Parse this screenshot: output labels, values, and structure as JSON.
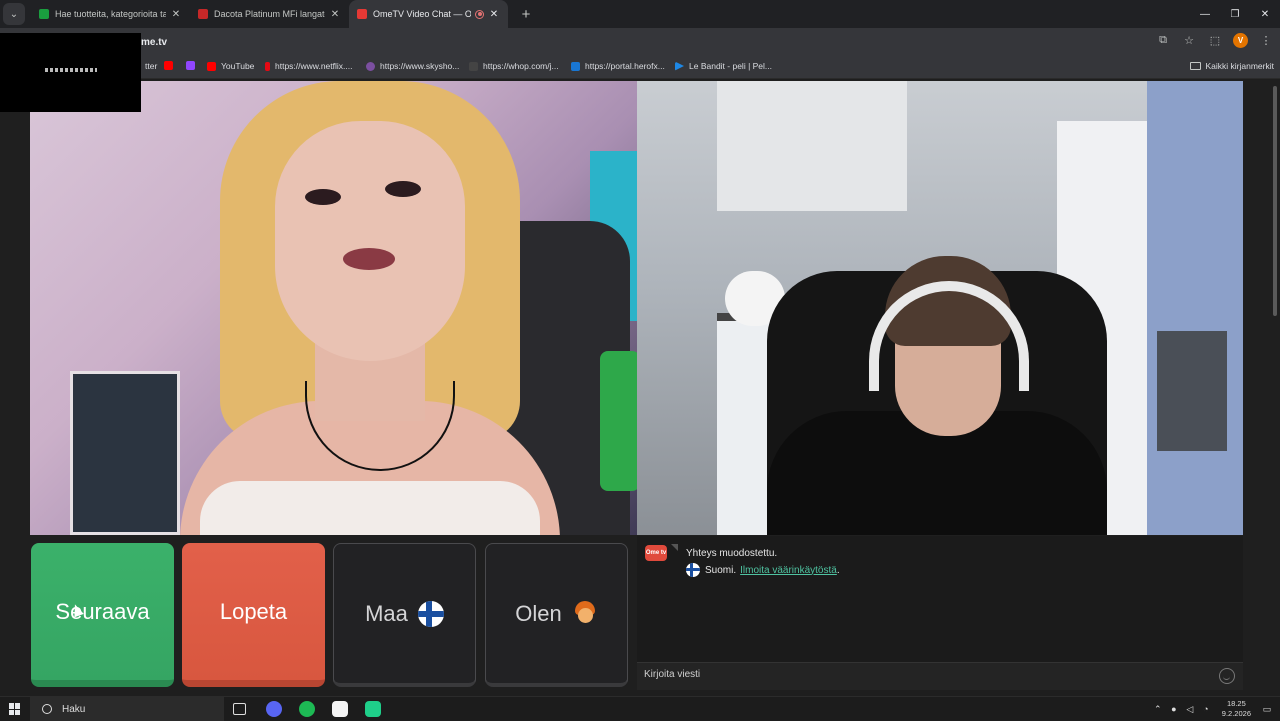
{
  "browser": {
    "tabs": [
      {
        "title": "Hae tuotteita, kategorioita tai a...",
        "favicon_color": "#1a9e3f",
        "active": false
      },
      {
        "title": "Dacota Platinum MFi langaton ...",
        "favicon_color": "#c62828",
        "active": false
      },
      {
        "title": "OmeTV Video Chat — Om...",
        "favicon_color": "#e53935",
        "active": true
      }
    ],
    "new_tab_label": "+",
    "url": "me.tv",
    "profile_initial": "V",
    "bookmarks": [
      {
        "label": "tter",
        "color": "#000000"
      },
      {
        "label": "",
        "color": "#ff0000"
      },
      {
        "label": "",
        "color": "#9146ff"
      },
      {
        "label": "YouTube",
        "color": "#ff0000"
      },
      {
        "label": "https://www.netflix....",
        "color": "#e50914"
      },
      {
        "label": "https://www.skysho...",
        "color": "#7b4fa0"
      },
      {
        "label": "https://whop.com/j...",
        "color": "#444444"
      },
      {
        "label": "https://portal.herofx...",
        "color": "#1976d2"
      },
      {
        "label": "Le Bandit - peli | Pel...",
        "color": "#1e88e5"
      }
    ],
    "all_bookmarks_label": "Kaikki kirjanmerkit"
  },
  "controls": {
    "next_label": "Seuraava",
    "stop_label": "Lopeta",
    "country_label": "Maa",
    "gender_label": "Olen",
    "next_color": "#3bb16a",
    "stop_color": "#e2604a"
  },
  "chat": {
    "logo_text": "Ome tv",
    "connected_message": "Yhteys muodostettu.",
    "country_prefix": "Suomi.",
    "report_link": "Ilmoita väärinkäytöstä",
    "report_suffix": ".",
    "input_placeholder": "Kirjoita viesti"
  },
  "taskbar": {
    "search_label": "Haku",
    "time": "18.25",
    "date": "9.2.2026",
    "apps": [
      {
        "icon": "task-view-icon",
        "color": "#dddddd"
      },
      {
        "icon": "discord-icon",
        "color": "#5865f2"
      },
      {
        "icon": "spotify-icon",
        "color": "#1db954"
      },
      {
        "icon": "file-explorer-icon",
        "color": "#f5f5f5"
      },
      {
        "icon": "app-green-icon",
        "color": "#1fcf8a"
      }
    ]
  }
}
